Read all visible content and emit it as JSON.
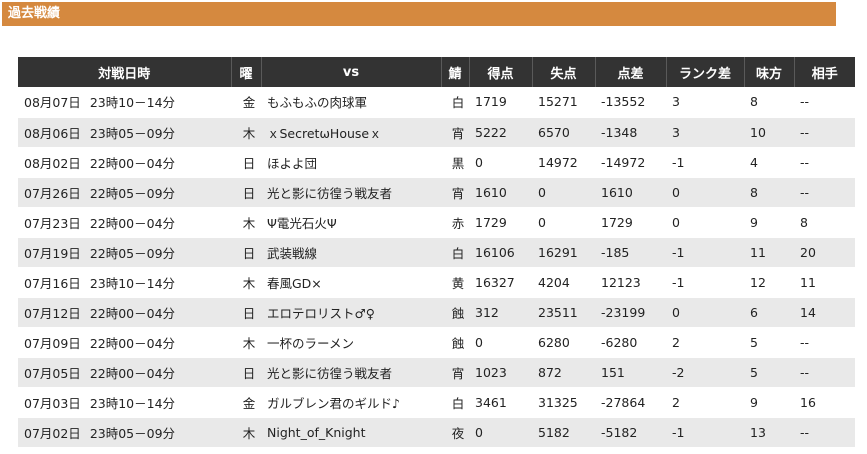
{
  "section_title": "過去戦績",
  "columns": [
    "対戦日時",
    "曜",
    "vs",
    "鯖",
    "得点",
    "失点",
    "点差",
    "ランク差",
    "味方",
    "相手"
  ],
  "rows": [
    {
      "date": "08月07日",
      "time": "23時10－14分",
      "day": "金",
      "vs": "もふもふの肉球軍",
      "server": "白",
      "score": "1719",
      "lost": "15271",
      "diff": "-13552",
      "rank": "3",
      "ally": "8",
      "enemy": "--"
    },
    {
      "date": "08月06日",
      "time": "23時05－09分",
      "day": "木",
      "vs": "ｘSecretωHouseｘ",
      "server": "宵",
      "score": "5222",
      "lost": "6570",
      "diff": "-1348",
      "rank": "3",
      "ally": "10",
      "enemy": "--"
    },
    {
      "date": "08月02日",
      "time": "22時00－04分",
      "day": "日",
      "vs": "ほよよ団",
      "server": "黒",
      "score": "0",
      "lost": "14972",
      "diff": "-14972",
      "rank": "-1",
      "ally": "4",
      "enemy": "--"
    },
    {
      "date": "07月26日",
      "time": "22時05－09分",
      "day": "日",
      "vs": "光と影に彷徨う戦友者",
      "server": "宵",
      "score": "1610",
      "lost": "0",
      "diff": "1610",
      "rank": "0",
      "ally": "8",
      "enemy": "--"
    },
    {
      "date": "07月23日",
      "time": "22時00－04分",
      "day": "木",
      "vs": "Ψ電光石火Ψ",
      "server": "赤",
      "score": "1729",
      "lost": "0",
      "diff": "1729",
      "rank": "0",
      "ally": "9",
      "enemy": "8"
    },
    {
      "date": "07月19日",
      "time": "22時05－09分",
      "day": "日",
      "vs": "武装戦線",
      "server": "白",
      "score": "16106",
      "lost": "16291",
      "diff": "-185",
      "rank": "-1",
      "ally": "11",
      "enemy": "20"
    },
    {
      "date": "07月16日",
      "time": "23時10－14分",
      "day": "木",
      "vs": "春風GD×",
      "server": "黄",
      "score": "16327",
      "lost": "4204",
      "diff": "12123",
      "rank": "-1",
      "ally": "12",
      "enemy": "11"
    },
    {
      "date": "07月12日",
      "time": "22時00－04分",
      "day": "日",
      "vs": "エロテロリスト♂♀",
      "server": "蝕",
      "score": "312",
      "lost": "23511",
      "diff": "-23199",
      "rank": "0",
      "ally": "6",
      "enemy": "14"
    },
    {
      "date": "07月09日",
      "time": "22時00－04分",
      "day": "木",
      "vs": "一杯のラーメン",
      "server": "蝕",
      "score": "0",
      "lost": "6280",
      "diff": "-6280",
      "rank": "2",
      "ally": "5",
      "enemy": "--"
    },
    {
      "date": "07月05日",
      "time": "22時00－04分",
      "day": "日",
      "vs": "光と影に彷徨う戦友者",
      "server": "宵",
      "score": "1023",
      "lost": "872",
      "diff": "151",
      "rank": "-2",
      "ally": "5",
      "enemy": "--"
    },
    {
      "date": "07月03日",
      "time": "23時10－14分",
      "day": "金",
      "vs": "ガルブレン君のギルド♪",
      "server": "白",
      "score": "3461",
      "lost": "31325",
      "diff": "-27864",
      "rank": "2",
      "ally": "9",
      "enemy": "16"
    },
    {
      "date": "07月02日",
      "time": "23時05－09分",
      "day": "木",
      "vs": "Night_of_Knight",
      "server": "夜",
      "score": "0",
      "lost": "5182",
      "diff": "-5182",
      "rank": "-1",
      "ally": "13",
      "enemy": "--"
    }
  ],
  "colors": {
    "header_bar": "#d5893f",
    "table_header": "#333333",
    "row_alt": "#e9e9e9"
  }
}
